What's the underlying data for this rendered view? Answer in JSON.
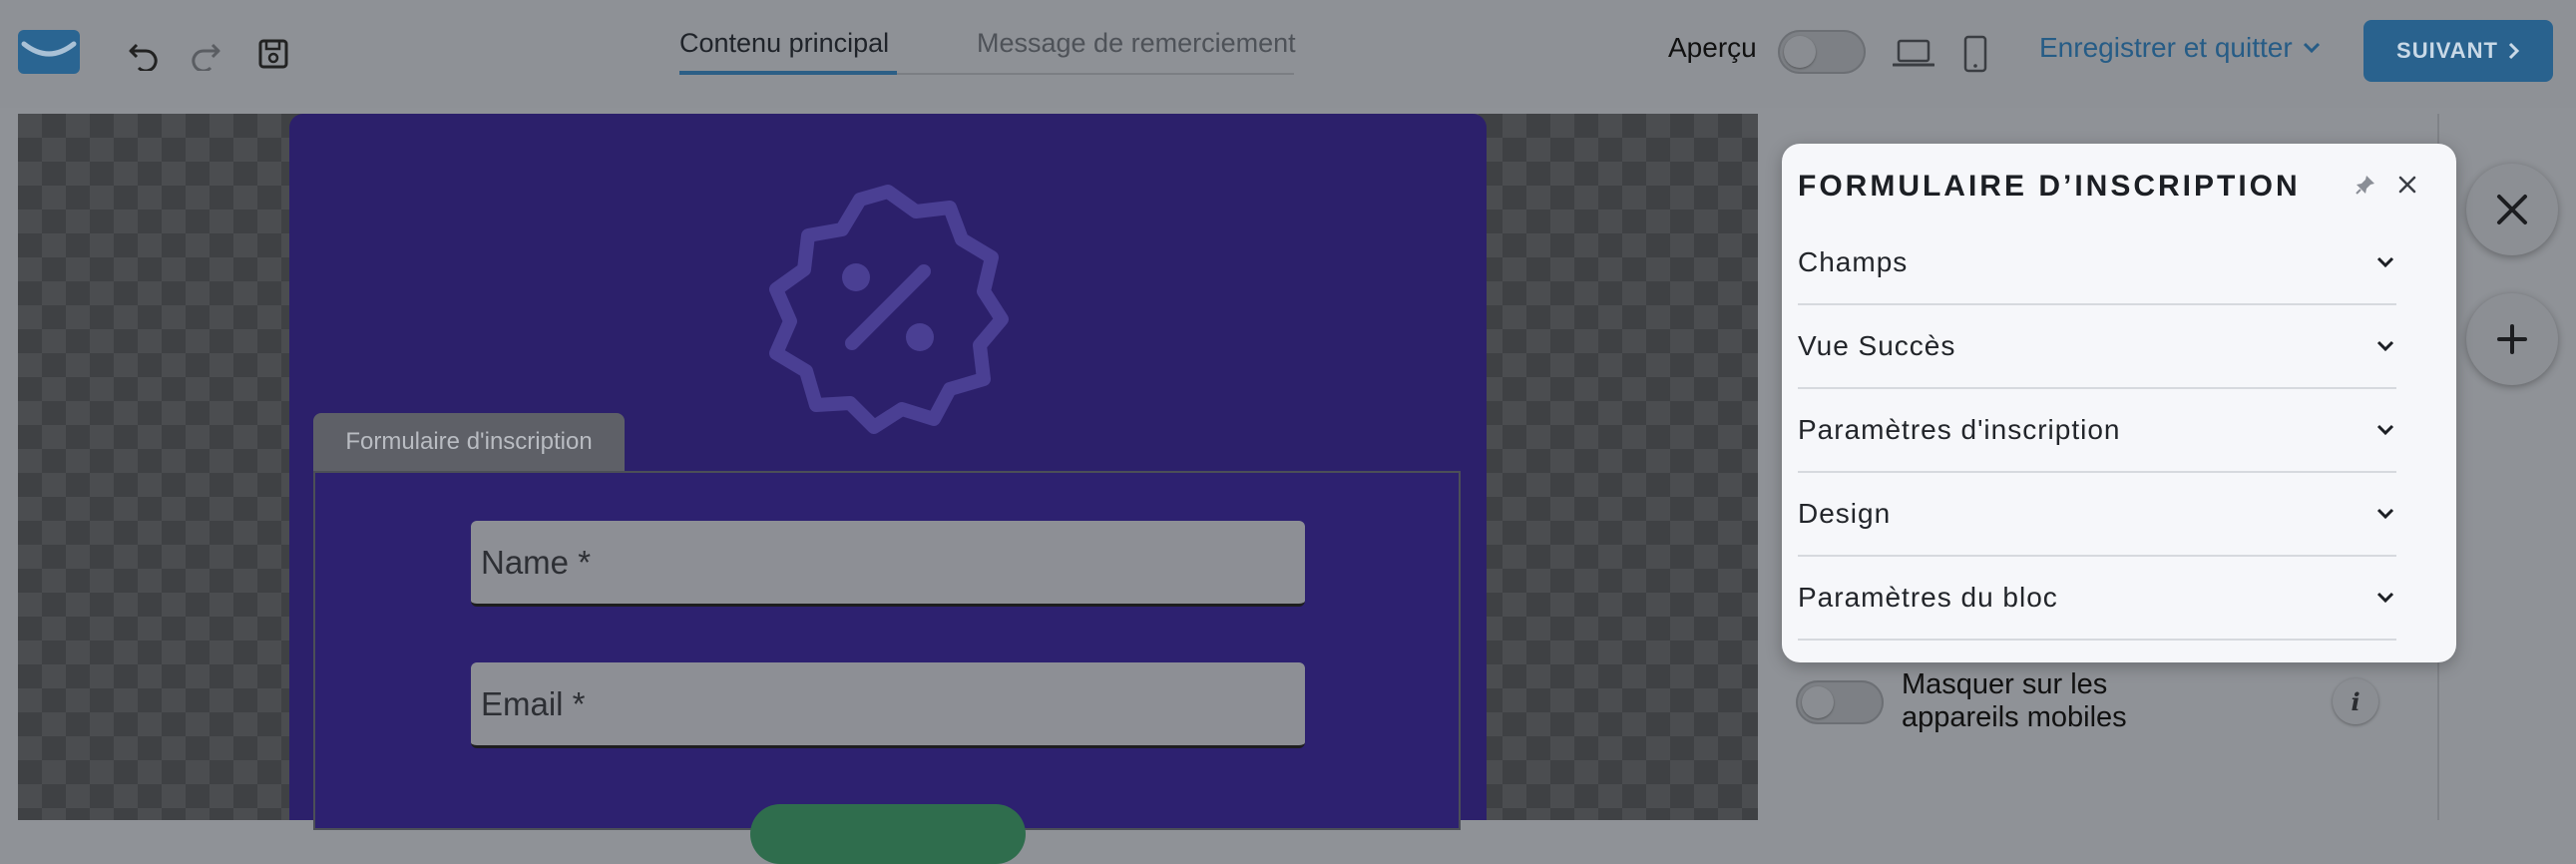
{
  "topbar": {
    "tabs": [
      {
        "label": "Contenu principal",
        "active": true
      },
      {
        "label": "Message de remerciement",
        "active": false
      }
    ],
    "preview_label": "Aperçu",
    "save_quit_label": "Enregistrer et quitter",
    "next_label": "SUIVANT",
    "icons": [
      "mail-logo-icon",
      "undo-icon",
      "redo-icon",
      "save-icon",
      "laptop-icon",
      "mobile-icon",
      "chevron-down-icon",
      "chevron-right-icon"
    ]
  },
  "canvas": {
    "block_tab_label": "Formulaire d'inscription",
    "fields": [
      {
        "placeholder": "Name *"
      },
      {
        "placeholder": "Email *"
      }
    ],
    "badge_icon": "discount-badge-icon"
  },
  "sidebar": {
    "mobile_toggle_label": "Masquer sur les appareils mobiles",
    "info_label": "i"
  },
  "panel": {
    "title": "FORMULAIRE D’INSCRIPTION",
    "items": [
      {
        "label": "Champs"
      },
      {
        "label": "Vue Succès"
      },
      {
        "label": "Paramètres d'inscription"
      },
      {
        "label": "Design"
      },
      {
        "label": "Paramètres du bloc"
      }
    ]
  },
  "colors": {
    "accent": "#265c86",
    "popup_bg": "#2c206b",
    "panel_bg": "#f6f7fa"
  }
}
